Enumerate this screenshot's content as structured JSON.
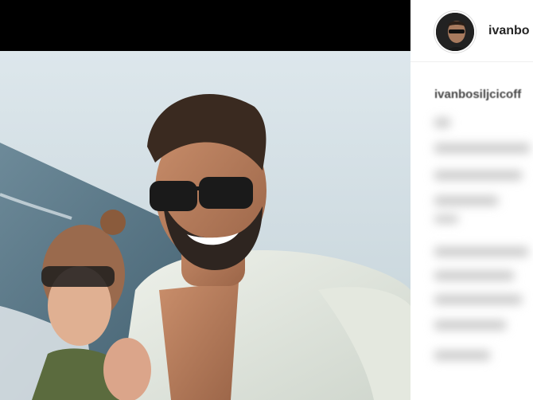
{
  "post": {
    "username": "ivanbo",
    "caption_username": "ivanbosiljcicoff"
  },
  "icons": {
    "avatar": "profile-avatar"
  },
  "colors": {
    "sidebar_bg": "#ffffff",
    "username": "#262626",
    "page_bg": "#000000"
  }
}
